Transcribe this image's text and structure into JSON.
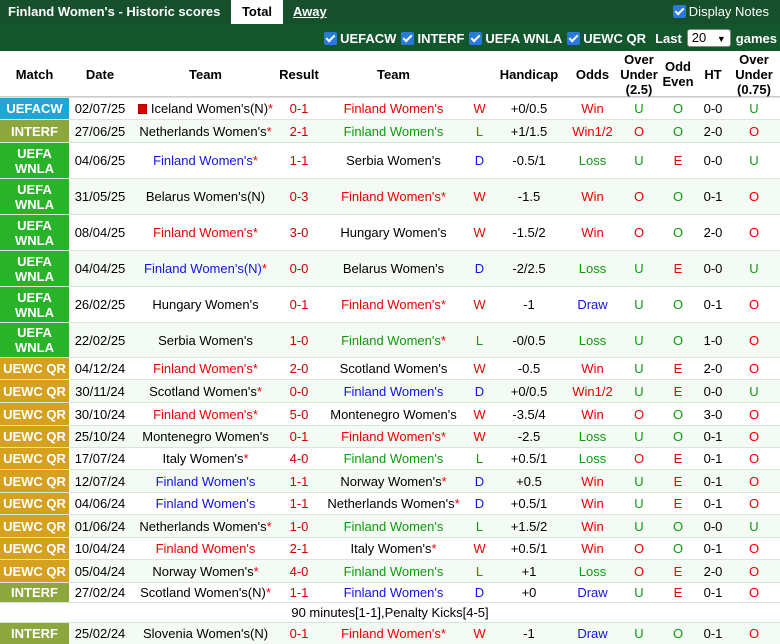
{
  "header": {
    "title": "Finland Women's - Historic scores",
    "tab_total": "Total",
    "tab_away": "Away",
    "display_notes": "Display Notes"
  },
  "filters": {
    "items": [
      "UEFACW",
      "INTERF",
      "UEFA WNLA",
      "UEWC QR"
    ],
    "last_label": "Last",
    "last_value": "20",
    "games_label": "games"
  },
  "columns": {
    "match": "Match",
    "date": "Date",
    "team_home": "Team",
    "result": "Result",
    "team_away": "Team",
    "handicap": "Handicap",
    "odds": "Odds",
    "over_under": "Over Under (2.5)",
    "odd_even": "Odd Even",
    "ht": "HT",
    "over_under2": "Over Under (0.75)"
  },
  "colors": {
    "UEFACW": "#1ea7d6",
    "INTERF": "#8da63d",
    "UEFA WNLA": "#29b329",
    "UEWC QR": "#d6a11f",
    "win": "#e00000",
    "draw": "#1212e6",
    "loss": "#109910"
  },
  "rows": [
    {
      "comp": "UEFACW",
      "date": "02/07/25",
      "home": "Iceland Women's(N)",
      "home_star": "*",
      "home_color": "black",
      "home_flag": true,
      "result": "0-1",
      "away": "Finland Women's",
      "away_star": "",
      "away_color": "red",
      "wl": "W",
      "handicap": "+0/0.5",
      "odds": "Win",
      "ou": "U",
      "oe": "O",
      "ht": "0-0",
      "ou2": "U"
    },
    {
      "comp": "INTERF",
      "date": "27/06/25",
      "home": "Netherlands Women's",
      "home_star": "*",
      "home_color": "black",
      "result": "2-1",
      "away": "Finland Women's",
      "away_star": "",
      "away_color": "green",
      "wl": "L",
      "handicap": "+1/1.5",
      "odds": "Win1/2",
      "ou": "O",
      "oe": "O",
      "ht": "2-0",
      "ou2": "O"
    },
    {
      "comp": "UEFA WNLA",
      "date": "04/06/25",
      "home": "Finland Women's",
      "home_star": "*",
      "home_color": "blue",
      "result": "1-1",
      "away": "Serbia Women's",
      "away_star": "",
      "away_color": "black",
      "wl": "D",
      "handicap": "-0.5/1",
      "odds": "Loss",
      "ou": "U",
      "oe": "E",
      "ht": "0-0",
      "ou2": "U"
    },
    {
      "comp": "UEFA WNLA",
      "date": "31/05/25",
      "home": "Belarus Women's(N)",
      "home_star": "",
      "home_color": "black",
      "result": "0-3",
      "away": "Finland Women's",
      "away_star": "*",
      "away_color": "red",
      "wl": "W",
      "handicap": "-1.5",
      "odds": "Win",
      "ou": "O",
      "oe": "O",
      "ht": "0-1",
      "ou2": "O"
    },
    {
      "comp": "UEFA WNLA",
      "date": "08/04/25",
      "home": "Finland Women's",
      "home_star": "*",
      "home_color": "red",
      "result": "3-0",
      "away": "Hungary Women's",
      "away_star": "",
      "away_color": "black",
      "wl": "W",
      "handicap": "-1.5/2",
      "odds": "Win",
      "ou": "O",
      "oe": "O",
      "ht": "2-0",
      "ou2": "O"
    },
    {
      "comp": "UEFA WNLA",
      "date": "04/04/25",
      "home": "Finland Women's(N)",
      "home_star": "*",
      "home_color": "blue",
      "result": "0-0",
      "away": "Belarus Women's",
      "away_star": "",
      "away_color": "black",
      "wl": "D",
      "handicap": "-2/2.5",
      "odds": "Loss",
      "ou": "U",
      "oe": "E",
      "ht": "0-0",
      "ou2": "U"
    },
    {
      "comp": "UEFA WNLA",
      "date": "26/02/25",
      "home": "Hungary Women's",
      "home_star": "",
      "home_color": "black",
      "result": "0-1",
      "away": "Finland Women's",
      "away_star": "*",
      "away_color": "red",
      "wl": "W",
      "handicap": "-1",
      "odds": "Draw",
      "ou": "U",
      "oe": "O",
      "ht": "0-1",
      "ou2": "O"
    },
    {
      "comp": "UEFA WNLA",
      "date": "22/02/25",
      "home": "Serbia Women's",
      "home_star": "",
      "home_color": "black",
      "result": "1-0",
      "away": "Finland Women's",
      "away_star": "*",
      "away_color": "green",
      "wl": "L",
      "handicap": "-0/0.5",
      "odds": "Loss",
      "ou": "U",
      "oe": "O",
      "ht": "1-0",
      "ou2": "O"
    },
    {
      "comp": "UEWC QR",
      "date": "04/12/24",
      "home": "Finland Women's",
      "home_star": "*",
      "home_color": "red",
      "result": "2-0",
      "away": "Scotland Women's",
      "away_star": "",
      "away_color": "black",
      "wl": "W",
      "handicap": "-0.5",
      "odds": "Win",
      "ou": "U",
      "oe": "E",
      "ht": "2-0",
      "ou2": "O"
    },
    {
      "comp": "UEWC QR",
      "date": "30/11/24",
      "home": "Scotland Women's",
      "home_star": "*",
      "home_color": "black",
      "result": "0-0",
      "away": "Finland Women's",
      "away_star": "",
      "away_color": "blue",
      "wl": "D",
      "handicap": "+0/0.5",
      "odds": "Win1/2",
      "ou": "U",
      "oe": "E",
      "ht": "0-0",
      "ou2": "U"
    },
    {
      "comp": "UEWC QR",
      "date": "30/10/24",
      "home": "Finland Women's",
      "home_star": "*",
      "home_color": "red",
      "result": "5-0",
      "away": "Montenegro Women's",
      "away_star": "",
      "away_color": "black",
      "wl": "W",
      "handicap": "-3.5/4",
      "odds": "Win",
      "ou": "O",
      "oe": "O",
      "ht": "3-0",
      "ou2": "O"
    },
    {
      "comp": "UEWC QR",
      "date": "25/10/24",
      "home": "Montenegro Women's",
      "home_star": "",
      "home_color": "black",
      "result": "0-1",
      "away": "Finland Women's",
      "away_star": "*",
      "away_color": "red",
      "wl": "W",
      "handicap": "-2.5",
      "odds": "Loss",
      "ou": "U",
      "oe": "O",
      "ht": "0-1",
      "ou2": "O"
    },
    {
      "comp": "UEWC QR",
      "date": "17/07/24",
      "home": "Italy Women's",
      "home_star": "*",
      "home_color": "black",
      "result": "4-0",
      "away": "Finland Women's",
      "away_star": "",
      "away_color": "green",
      "wl": "L",
      "handicap": "+0.5/1",
      "odds": "Loss",
      "ou": "O",
      "oe": "E",
      "ht": "0-1",
      "ou2": "O"
    },
    {
      "comp": "UEWC QR",
      "date": "12/07/24",
      "home": "Finland Women's",
      "home_star": "",
      "home_color": "blue",
      "result": "1-1",
      "away": "Norway Women's",
      "away_star": "*",
      "away_color": "black",
      "wl": "D",
      "handicap": "+0.5",
      "odds": "Win",
      "ou": "U",
      "oe": "E",
      "ht": "0-1",
      "ou2": "O"
    },
    {
      "comp": "UEWC QR",
      "date": "04/06/24",
      "home": "Finland Women's",
      "home_star": "",
      "home_color": "blue",
      "result": "1-1",
      "away": "Netherlands Women's",
      "away_star": "*",
      "away_color": "black",
      "wl": "D",
      "handicap": "+0.5/1",
      "odds": "Win",
      "ou": "U",
      "oe": "E",
      "ht": "0-1",
      "ou2": "O"
    },
    {
      "comp": "UEWC QR",
      "date": "01/06/24",
      "home": "Netherlands Women's",
      "home_star": "*",
      "home_color": "black",
      "result": "1-0",
      "away": "Finland Women's",
      "away_star": "",
      "away_color": "green",
      "wl": "L",
      "handicap": "+1.5/2",
      "odds": "Win",
      "ou": "U",
      "oe": "O",
      "ht": "0-0",
      "ou2": "U"
    },
    {
      "comp": "UEWC QR",
      "date": "10/04/24",
      "home": "Finland Women's",
      "home_star": "",
      "home_color": "red",
      "result": "2-1",
      "away": "Italy Women's",
      "away_star": "*",
      "away_color": "black",
      "wl": "W",
      "handicap": "+0.5/1",
      "odds": "Win",
      "ou": "O",
      "oe": "O",
      "ht": "0-1",
      "ou2": "O"
    },
    {
      "comp": "UEWC QR",
      "date": "05/04/24",
      "home": "Norway Women's",
      "home_star": "*",
      "home_color": "black",
      "result": "4-0",
      "away": "Finland Women's",
      "away_star": "",
      "away_color": "green",
      "wl": "L",
      "handicap": "+1",
      "odds": "Loss",
      "ou": "O",
      "oe": "E",
      "ht": "2-0",
      "ou2": "O"
    },
    {
      "comp": "INTERF",
      "date": "27/02/24",
      "home": "Scotland Women's(N)",
      "home_star": "*",
      "home_color": "black",
      "result": "1-1",
      "away": "Finland Women's",
      "away_star": "",
      "away_color": "blue",
      "wl": "D",
      "handicap": "+0",
      "odds": "Draw",
      "ou": "U",
      "oe": "E",
      "ht": "0-1",
      "ou2": "O"
    },
    {
      "comp": "INTERF",
      "date": "25/02/24",
      "home": "Slovenia Women's(N)",
      "home_star": "",
      "home_color": "black",
      "result": "0-1",
      "away": "Finland Women's",
      "away_star": "*",
      "away_color": "red",
      "wl": "W",
      "handicap": "-1",
      "odds": "Draw",
      "ou": "U",
      "oe": "O",
      "ht": "0-1",
      "ou2": "O"
    }
  ],
  "note_text": "90 minutes[1-1],Penalty Kicks[4-5]"
}
